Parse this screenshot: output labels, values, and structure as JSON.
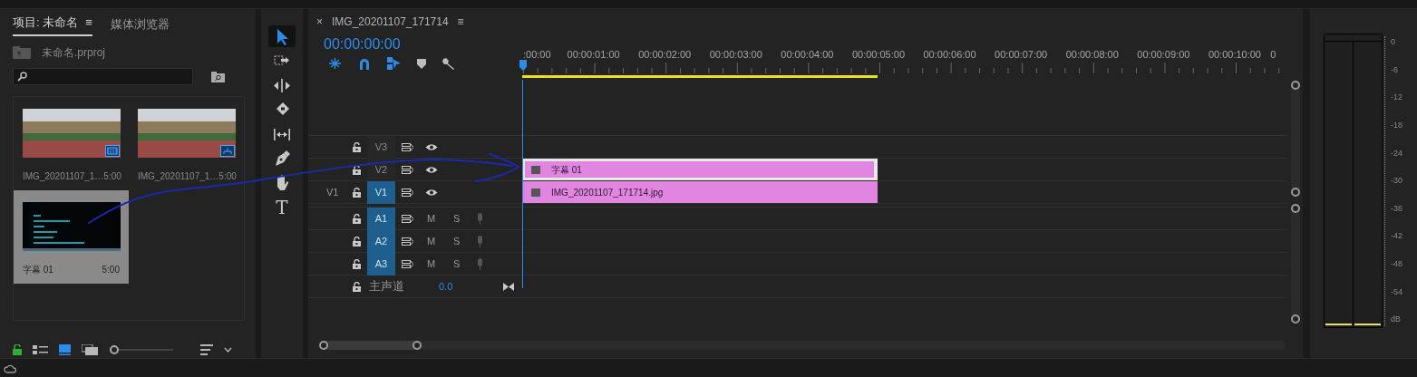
{
  "project_panel": {
    "tabs": [
      {
        "label": "项目: 未命名",
        "selected": true
      },
      {
        "label": "媒体浏览器",
        "selected": false
      }
    ],
    "tab_menu": "≡",
    "project_file": "未命名.prproj",
    "items": [
      {
        "kind": "video",
        "name": "IMG_20201107_1…",
        "duration": "5:00",
        "selected": false
      },
      {
        "kind": "sequence",
        "name": "IMG_20201107_1…",
        "duration": "5:00",
        "selected": false
      },
      {
        "kind": "title",
        "name": "字幕 01",
        "duration": "5:00",
        "selected": true
      }
    ],
    "view_modes": [
      {
        "kind": "list",
        "selected": false
      },
      {
        "kind": "icon",
        "selected": true
      },
      {
        "kind": "freeform",
        "selected": false
      }
    ],
    "zoom": {
      "level": 0
    }
  },
  "tools": [
    {
      "kind": "selection",
      "selected": true
    },
    {
      "kind": "track-select",
      "selected": false
    },
    {
      "kind": "ripple",
      "selected": false
    },
    {
      "kind": "razor",
      "selected": false
    },
    {
      "kind": "slip",
      "selected": false
    },
    {
      "kind": "pen",
      "selected": false
    },
    {
      "kind": "hand",
      "selected": false
    },
    {
      "kind": "type",
      "label": "T",
      "selected": false
    }
  ],
  "timeline": {
    "close": "×",
    "title": "IMG_20201107_171714",
    "menu": "≡",
    "timecode": "00:00:00:00",
    "ruler": [
      ":00:00",
      "00:00:01:00",
      "00:00:02:00",
      "00:00:03:00",
      "00:00:04:00",
      "00:00:05:00",
      "00:00:06:00",
      "00:00:07:00",
      "00:00:08:00",
      "00:00:09:00",
      "00:00:10:00",
      "0"
    ],
    "tracks": [
      {
        "kind": "video",
        "name": "V3",
        "targeted": false
      },
      {
        "kind": "video",
        "name": "V2",
        "targeted": false,
        "clips": [
          {
            "label": "字幕 01",
            "selected": true
          }
        ]
      },
      {
        "kind": "video",
        "name": "V1",
        "source": "V1",
        "targeted": true,
        "clips": [
          {
            "label": "IMG_20201107_171714.jpg",
            "selected": false
          }
        ]
      },
      {
        "kind": "audio",
        "name": "A1",
        "targeted": true,
        "mute": "M",
        "solo": "S"
      },
      {
        "kind": "audio",
        "name": "A2",
        "targeted": true,
        "mute": "M",
        "solo": "S"
      },
      {
        "kind": "audio",
        "name": "A3",
        "targeted": true,
        "mute": "M",
        "solo": "S"
      },
      {
        "kind": "master",
        "name": "主声道",
        "volume": "0.0"
      }
    ]
  },
  "audio_meter": {
    "scale": [
      "0",
      "-6",
      "-12",
      "-18",
      "-24",
      "-30",
      "-36",
      "-42",
      "-48",
      "-54",
      "dB"
    ]
  }
}
